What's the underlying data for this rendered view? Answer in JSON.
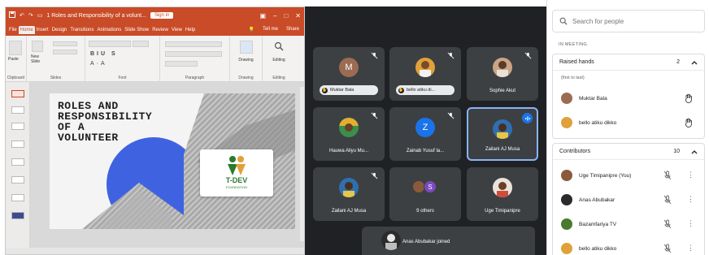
{
  "powerpoint": {
    "title": "1 Roles and Responsibility of a volunt...",
    "sign_in": "Sign in",
    "menu": [
      "File",
      "Home",
      "Insert",
      "Design",
      "Transitions",
      "Animations",
      "Slide Show",
      "Review",
      "View",
      "Help"
    ],
    "tell_me": "Tell me",
    "share": "Share",
    "ribbon_groups": [
      "Clipboard",
      "Slides",
      "Font",
      "Paragraph",
      "Drawing",
      "Editing"
    ],
    "ribbon_buttons": {
      "paste": "Paste",
      "new_slide": "New Slide",
      "drawing": "Drawing",
      "editing": "Editing"
    },
    "slide": {
      "title_line1": "ROLES AND",
      "title_line2": "RESPONSIBILITY",
      "title_line3": "OF A",
      "title_line4": "VOLUNTEER",
      "logo_text": "T-DEV",
      "logo_subtext": "FOUNDATION"
    },
    "accent": "#c94b27"
  },
  "meet": {
    "tiles": [
      {
        "name": "Muktar Bala",
        "initial": "M",
        "raised": true,
        "avatar_color": "#9c6b53"
      },
      {
        "name": "bello atiku di...",
        "initial": "",
        "raised": true,
        "avatar_color": "#e0a13a"
      },
      {
        "name": "Sophie Akut",
        "initial": "",
        "raised": false,
        "avatar_color": "#caa585"
      },
      {
        "name": "Hauwa Aliyu Mu...",
        "initial": "",
        "raised": false,
        "avatar_color": "#3a8f4c"
      },
      {
        "name": "Zainab Yusuf la...",
        "initial": "Z",
        "raised": false,
        "avatar_color": "#1a73e8"
      },
      {
        "name": "Zailani AJ Musa",
        "initial": "",
        "raised": false,
        "avatar_color": "#2f6fb0",
        "speaking": true
      },
      {
        "name": "Zailani AJ Musa",
        "initial": "",
        "raised": false,
        "avatar_color": "#2f6fb0"
      },
      {
        "name": "9 others",
        "initial": "S",
        "raised": false,
        "avatar_color": "#7b4bbd"
      },
      {
        "name": "Uge Timipanipre",
        "initial": "",
        "raised": false,
        "avatar_color": "#8a5a3c"
      }
    ],
    "toast": "Anas Abubakar joined",
    "speaking_color": "#8ab4f8"
  },
  "people": {
    "search_placeholder": "Search for people",
    "in_meeting_label": "IN MEETING",
    "raised_hands": {
      "label": "Raised hands",
      "count": "2",
      "order_note": "(first to last)",
      "people": [
        {
          "name": "Muktar Bala",
          "avatar_color": "#9c6b53"
        },
        {
          "name": "bello atiku dikko",
          "avatar_color": "#e0a13a"
        }
      ]
    },
    "contributors": {
      "label": "Contributors",
      "count": "10",
      "people": [
        {
          "name": "Uge Timipanipre (You)",
          "avatar_color": "#8a5a3c"
        },
        {
          "name": "Anas Abubakar",
          "avatar_color": "#2b2b2b"
        },
        {
          "name": "Bazamfariya TV",
          "avatar_color": "#4a7a2e"
        },
        {
          "name": "bello atiku dikko",
          "avatar_color": "#e0a13a"
        }
      ]
    }
  }
}
